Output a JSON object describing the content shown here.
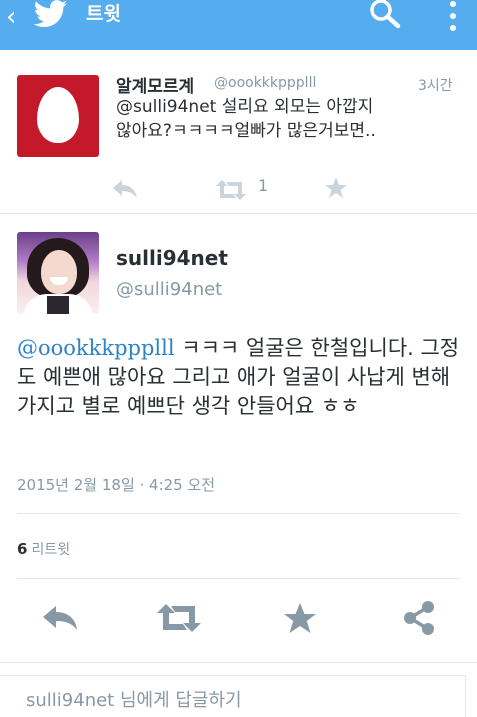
{
  "header": {
    "back_icon": "chevron-left-icon",
    "logo_icon": "twitter-bird-icon",
    "title": "트윗",
    "search_icon": "search-icon",
    "more_icon": "overflow-menu-icon",
    "bar_color": "#55acee"
  },
  "parent_tweet": {
    "display_name": "알계모르계",
    "handle": "@oookkkppplll",
    "time": "3시간",
    "text": "@sulli94net 설리요 외모는 아깝지않아요?ㅋㅋㅋㅋ얼빠가 많은거보면..",
    "retweet_count": "1",
    "avatar_color": "#c4192b"
  },
  "tweet": {
    "display_name": "sulli94net",
    "handle": "@sulli94net",
    "mention": "@oookkkppplll",
    "text": " ㅋㅋㅋ 얼굴은 한철입니다. 그정도 예쁜애 많아요 그리고 애가 얼굴이 사납게 변해가지고 별로 예쁘단 생각 안들어요 ㅎㅎ",
    "date": "2015년 2월 18일 · 4:25 오전",
    "retweet_count": "6",
    "retweet_label": "리트윗"
  },
  "composer": {
    "placeholder": "sulli94net 님에게 답글하기"
  },
  "colors": {
    "link": "#2e82c6",
    "secondary_text": "#8899a6",
    "action_icon": "#8899a6"
  }
}
